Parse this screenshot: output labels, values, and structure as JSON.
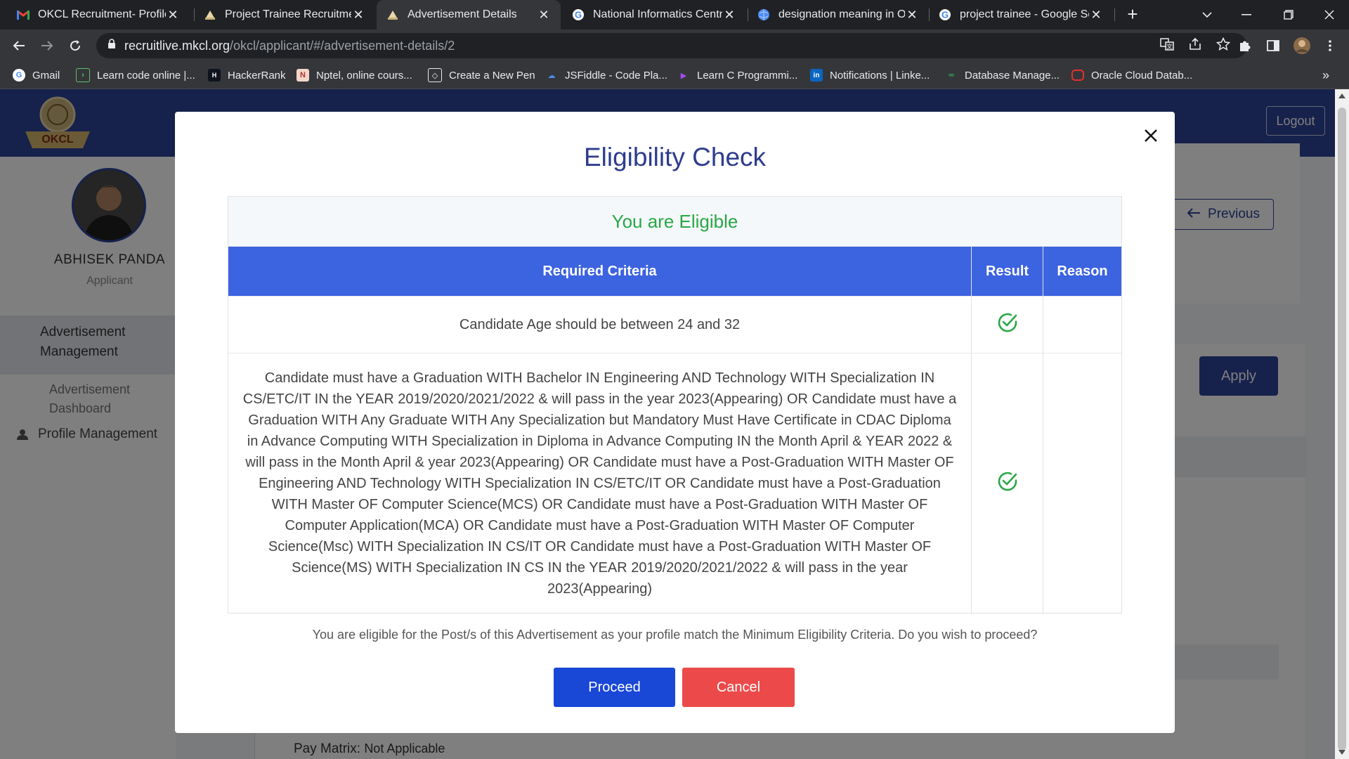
{
  "browser": {
    "tabs": [
      {
        "title": "OKCL Recruitment- Profile C",
        "icon": "gmail-icon"
      },
      {
        "title": "Project Trainee Recruitment",
        "icon": "site-icon"
      },
      {
        "title": "Advertisement Details",
        "icon": "site-icon",
        "active": true
      },
      {
        "title": "National Informatics Centre",
        "icon": "google-icon"
      },
      {
        "title": "designation meaning in Ori",
        "icon": "globe-icon"
      },
      {
        "title": "project trainee - Google Se",
        "icon": "google-icon"
      }
    ],
    "url_host": "recruitlive.mkcl.org",
    "url_path": "/okcl/applicant/#/advertisement-details/2",
    "bookmarks": [
      "Gmail",
      "Learn code online |...",
      "HackerRank",
      "Nptel, online cours...",
      "Create a New Pen",
      "JSFiddle - Code Pla...",
      "Learn C Programmi...",
      "Notifications | Linke...",
      "Database Manage...",
      "Oracle Cloud Datab..."
    ],
    "more_bookmarks": "»"
  },
  "page": {
    "logout_label": "Logout",
    "logo_text": "OKCL",
    "user_name": "ABHISEK PANDA",
    "user_role": "Applicant",
    "menu_active": "Advertisement Management",
    "submenu": "Advertisement Dashboard",
    "menu_profile": "Profile Management",
    "previous_label": "Previous",
    "apply_label": "Apply",
    "pay_matrix_label": "Pay Matrix:",
    "pay_matrix_value": "Not Applicable"
  },
  "modal": {
    "title": "Eligibility Check",
    "status": "You are Eligible",
    "columns": [
      "Required Criteria",
      "Result",
      "Reason"
    ],
    "rows": [
      {
        "criteria": "Candidate Age should be between 24 and 32",
        "result": "pass",
        "reason": ""
      },
      {
        "criteria": "Candidate must have a Graduation WITH Bachelor IN Engineering AND Technology WITH Specialization IN CS/ETC/IT IN the YEAR 2019/2020/2021/2022 & will pass in the year 2023(Appearing) OR Candidate must have a Graduation WITH Any Graduate WITH Any Specialization but Mandatory Must Have Certificate in CDAC Diploma in Advance Computing WITH Specialization in Diploma in Advance Computing IN the Month April & YEAR 2022 & will pass in the Month April & year 2023(Appearing) OR Candidate must have a Post-Graduation WITH Master OF Engineering AND Technology WITH Specialization IN CS/ETC/IT OR Candidate must have a Post-Graduation WITH Master OF Computer Science(MCS) OR Candidate must have a Post-Graduation WITH Master OF Computer Application(MCA) OR Candidate must have a Post-Graduation WITH Master OF Computer Science(Msc) WITH Specialization IN CS/IT OR Candidate must have a Post-Graduation WITH Master OF Science(MS) WITH Specialization IN CS IN the YEAR 2019/2020/2021/2022 & will pass in the year 2023(Appearing)",
        "result": "pass",
        "reason": ""
      }
    ],
    "message": "You are eligible for the Post/s of this Advertisement as your profile match the Minimum Eligibility Criteria. Do you wish to proceed?",
    "proceed_label": "Proceed",
    "cancel_label": "Cancel"
  },
  "colors": {
    "header": "#2d4299",
    "table_header": "#3c63e0",
    "eligible": "#28a745",
    "proceed": "#1947d6",
    "cancel": "#ec4a4a"
  }
}
